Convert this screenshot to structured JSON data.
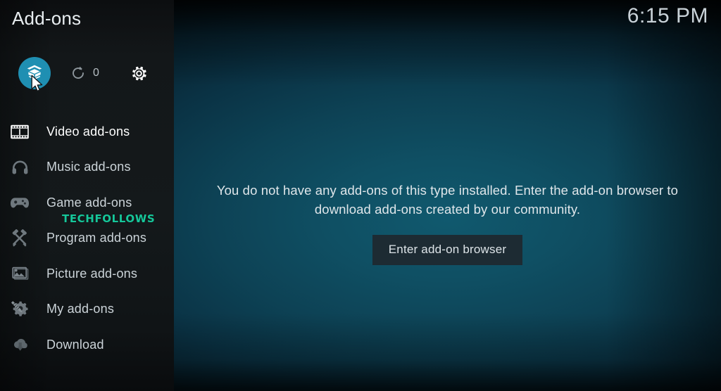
{
  "window": {
    "title": "Add-ons",
    "clock": "6:15 PM"
  },
  "toolbar": {
    "addons_icon": "addon-box-icon",
    "refresh_icon": "refresh-icon",
    "update_count": "0",
    "settings_icon": "gear-icon"
  },
  "sidebar": {
    "items": [
      {
        "label": "Video add-ons",
        "icon": "film-strip-icon",
        "active": true
      },
      {
        "label": "Music add-ons",
        "icon": "headphones-icon",
        "active": false
      },
      {
        "label": "Game add-ons",
        "icon": "gamepad-icon",
        "active": false
      },
      {
        "label": "Program add-ons",
        "icon": "tools-icon",
        "active": false
      },
      {
        "label": "Picture add-ons",
        "icon": "photo-icon",
        "active": false
      },
      {
        "label": "My add-ons",
        "icon": "gear-wrench-icon",
        "active": false
      },
      {
        "label": "Download",
        "icon": "cloud-download-icon",
        "active": false
      }
    ]
  },
  "main": {
    "empty_message": "You do not have any add-ons of this type installed. Enter the add-on browser to download add-ons created by our community.",
    "browser_button": "Enter add-on browser"
  },
  "watermark": {
    "text": "TECHFOLLOWS",
    "color": "#16c79a"
  },
  "colors": {
    "accent": "#1f8fb2",
    "background_teal": "#10596e",
    "sidebar": "#14191b",
    "button": "#1d2b33",
    "text_primary": "#e8edf0",
    "text_secondary": "#ccd4d9"
  },
  "cursor": {
    "icon": "mouse-pointer-icon"
  }
}
